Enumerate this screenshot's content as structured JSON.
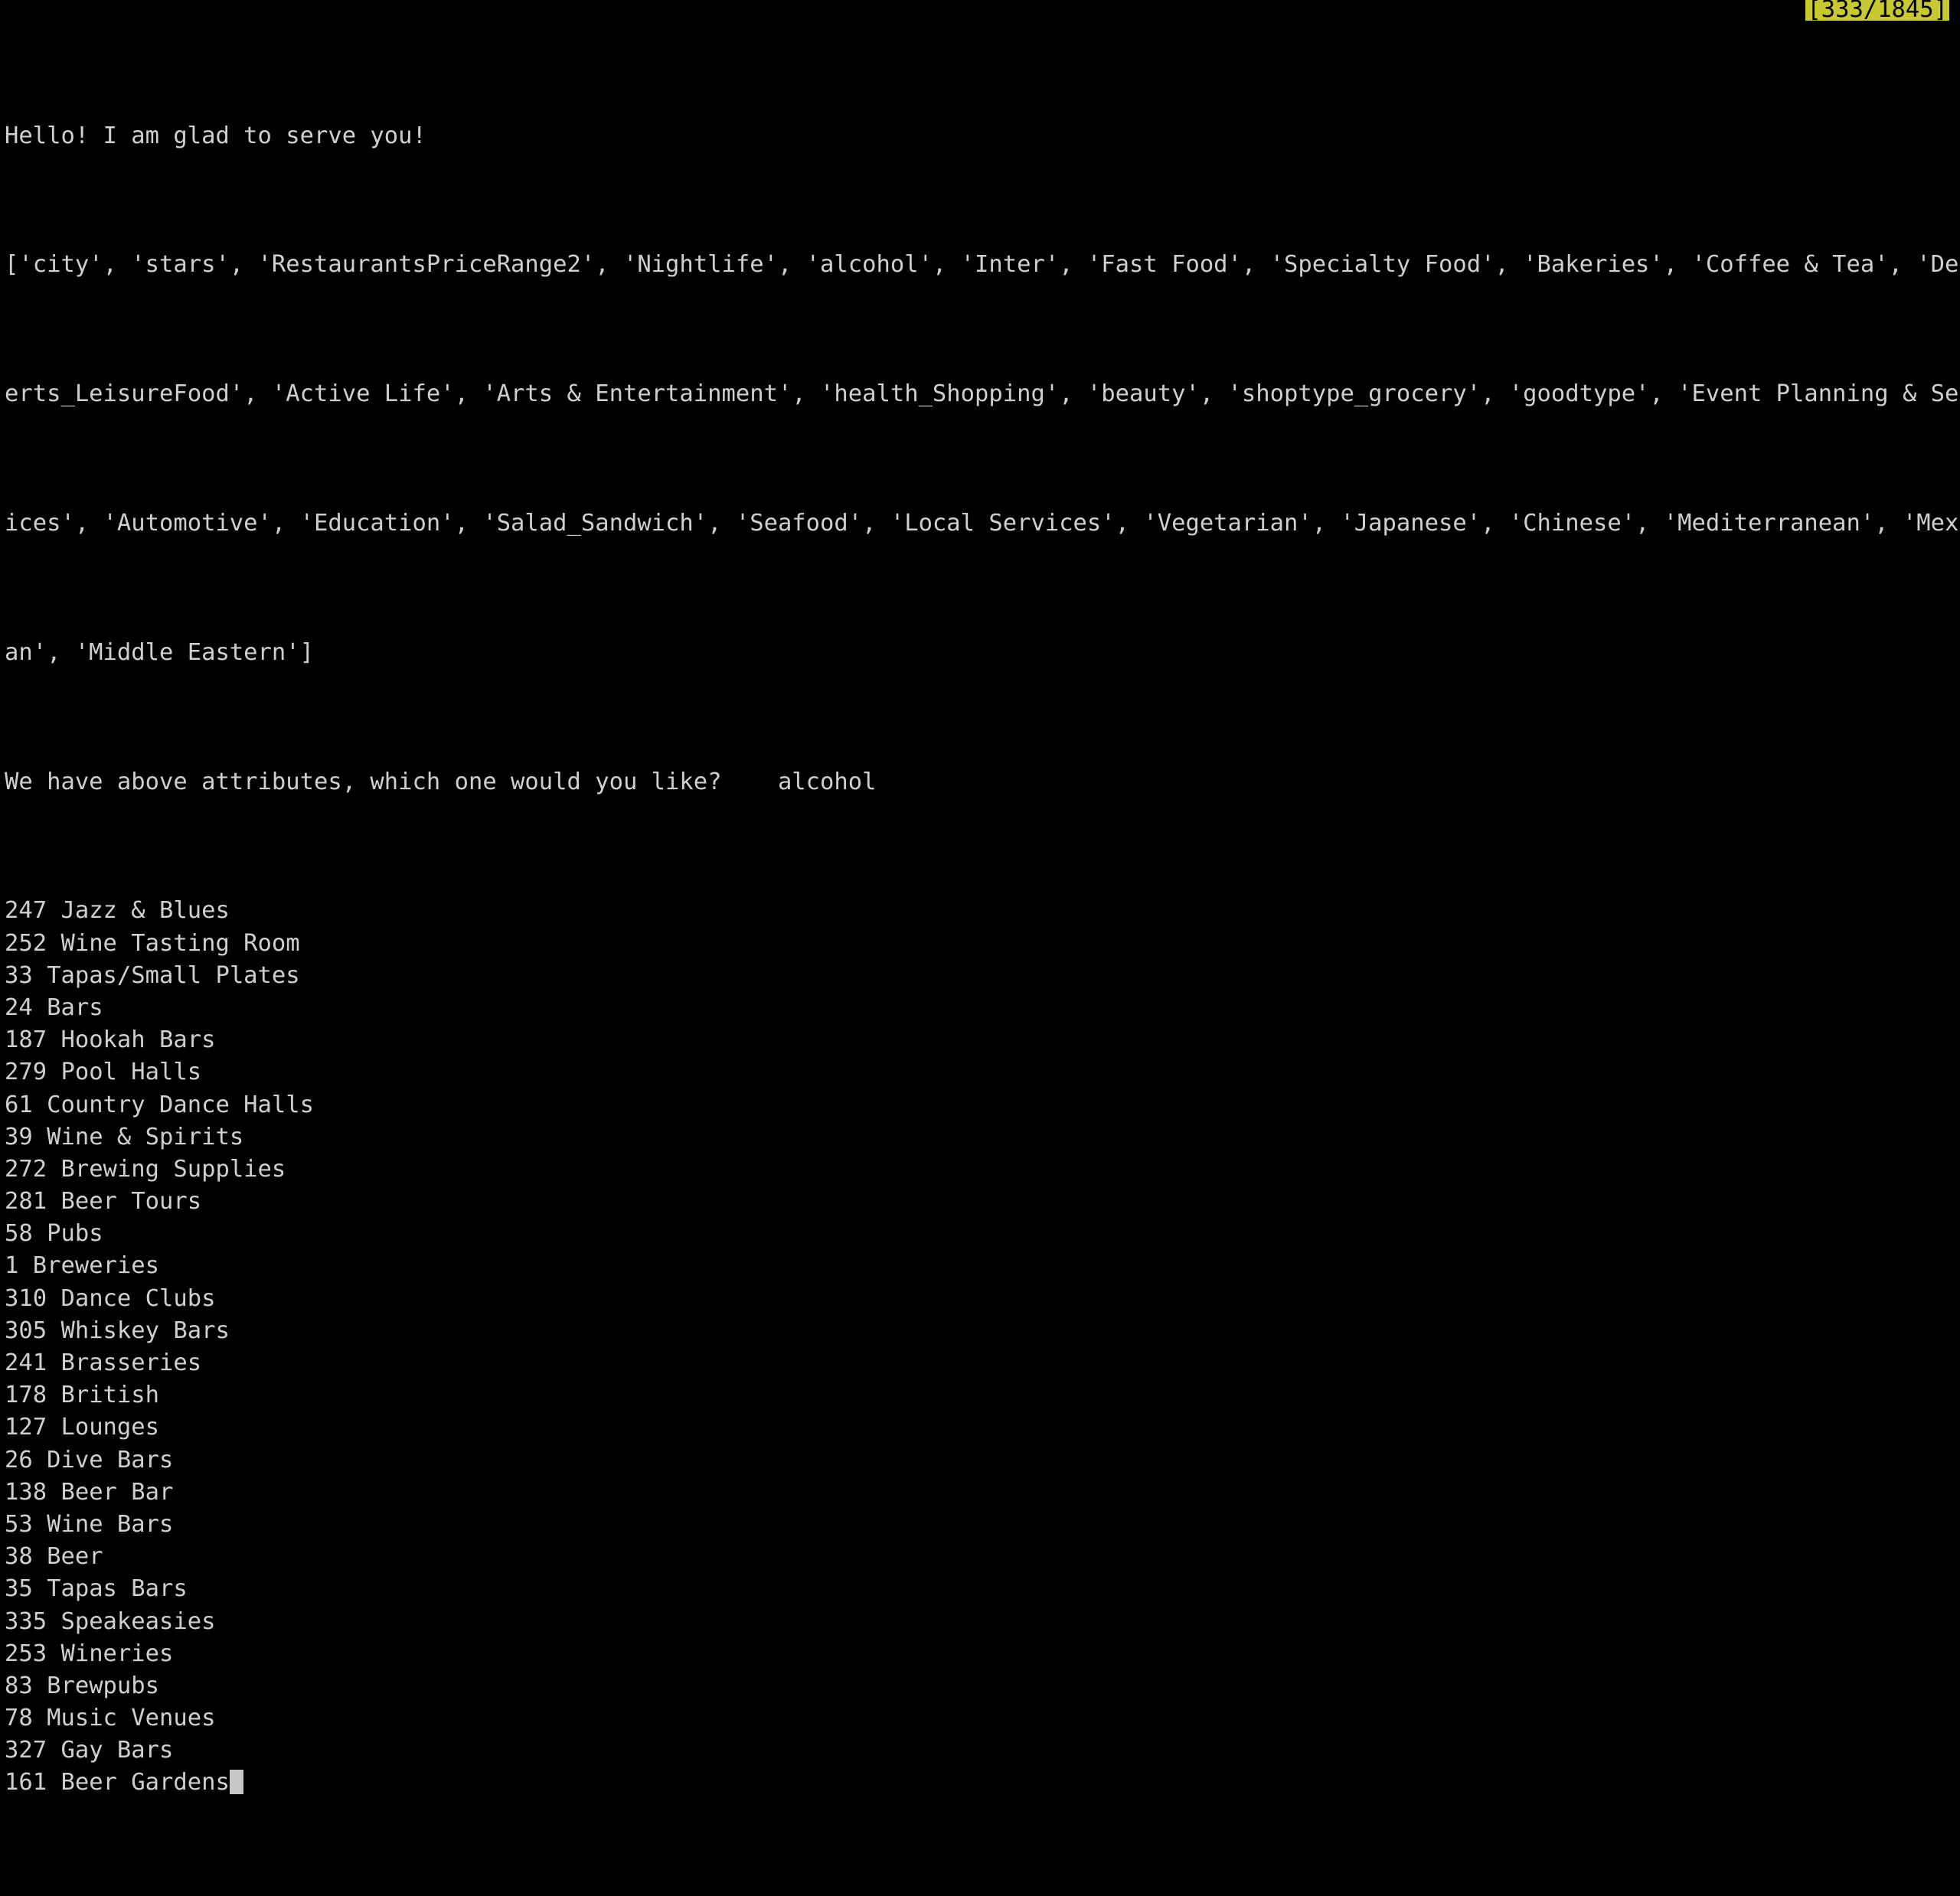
{
  "terminal": {
    "status_badge": "[333/1845]",
    "badge_bg_color": "#c8c832",
    "badge_fg_color": "#000000",
    "background_color": "#000000",
    "foreground_color": "#cfcfcf",
    "cursor_color": "#c6c6c6",
    "greeting": "Hello! I am glad to serve you!",
    "attribute_list_lines": [
      "['city', 'stars', 'RestaurantsPriceRange2', 'Nightlife', 'alcohol', 'Inter', 'Fast Food', 'Specialty Food', 'Bakeries', 'Coffee & Tea', 'Des$",
      "erts_LeisureFood', 'Active Life', 'Arts & Entertainment', 'health_Shopping', 'beauty', 'shoptype_grocery', 'goodtype', 'Event Planning & Ser$",
      "ices', 'Automotive', 'Education', 'Salad_Sandwich', 'Seafood', 'Local Services', 'Vegetarian', 'Japanese', 'Chinese', 'Mediterranean', 'Mexi$",
      "an', 'Middle Eastern']"
    ],
    "prompt_question": "We have above attributes, which one would you like?",
    "prompt_answer": "alcohol",
    "prompt_line": "We have above attributes, which one would you like?    alcohol",
    "results": [
      {
        "id": "247",
        "name": "Jazz & Blues"
      },
      {
        "id": "252",
        "name": "Wine Tasting Room"
      },
      {
        "id": "33",
        "name": "Tapas/Small Plates"
      },
      {
        "id": "24",
        "name": "Bars"
      },
      {
        "id": "187",
        "name": "Hookah Bars"
      },
      {
        "id": "279",
        "name": "Pool Halls"
      },
      {
        "id": "61",
        "name": "Country Dance Halls"
      },
      {
        "id": "39",
        "name": "Wine & Spirits"
      },
      {
        "id": "272",
        "name": "Brewing Supplies"
      },
      {
        "id": "281",
        "name": "Beer Tours"
      },
      {
        "id": "58",
        "name": "Pubs"
      },
      {
        "id": "1",
        "name": "Breweries"
      },
      {
        "id": "310",
        "name": "Dance Clubs"
      },
      {
        "id": "305",
        "name": "Whiskey Bars"
      },
      {
        "id": "241",
        "name": "Brasseries"
      },
      {
        "id": "178",
        "name": "British"
      },
      {
        "id": "127",
        "name": "Lounges"
      },
      {
        "id": "26",
        "name": "Dive Bars"
      },
      {
        "id": "138",
        "name": "Beer Bar"
      },
      {
        "id": "53",
        "name": "Wine Bars"
      },
      {
        "id": "38",
        "name": "Beer"
      },
      {
        "id": "35",
        "name": "Tapas Bars"
      },
      {
        "id": "335",
        "name": "Speakeasies"
      },
      {
        "id": "253",
        "name": "Wineries"
      },
      {
        "id": "83",
        "name": "Brewpubs"
      },
      {
        "id": "78",
        "name": "Music Venues"
      },
      {
        "id": "327",
        "name": "Gay Bars"
      },
      {
        "id": "161",
        "name": "Beer Gardens"
      }
    ]
  }
}
